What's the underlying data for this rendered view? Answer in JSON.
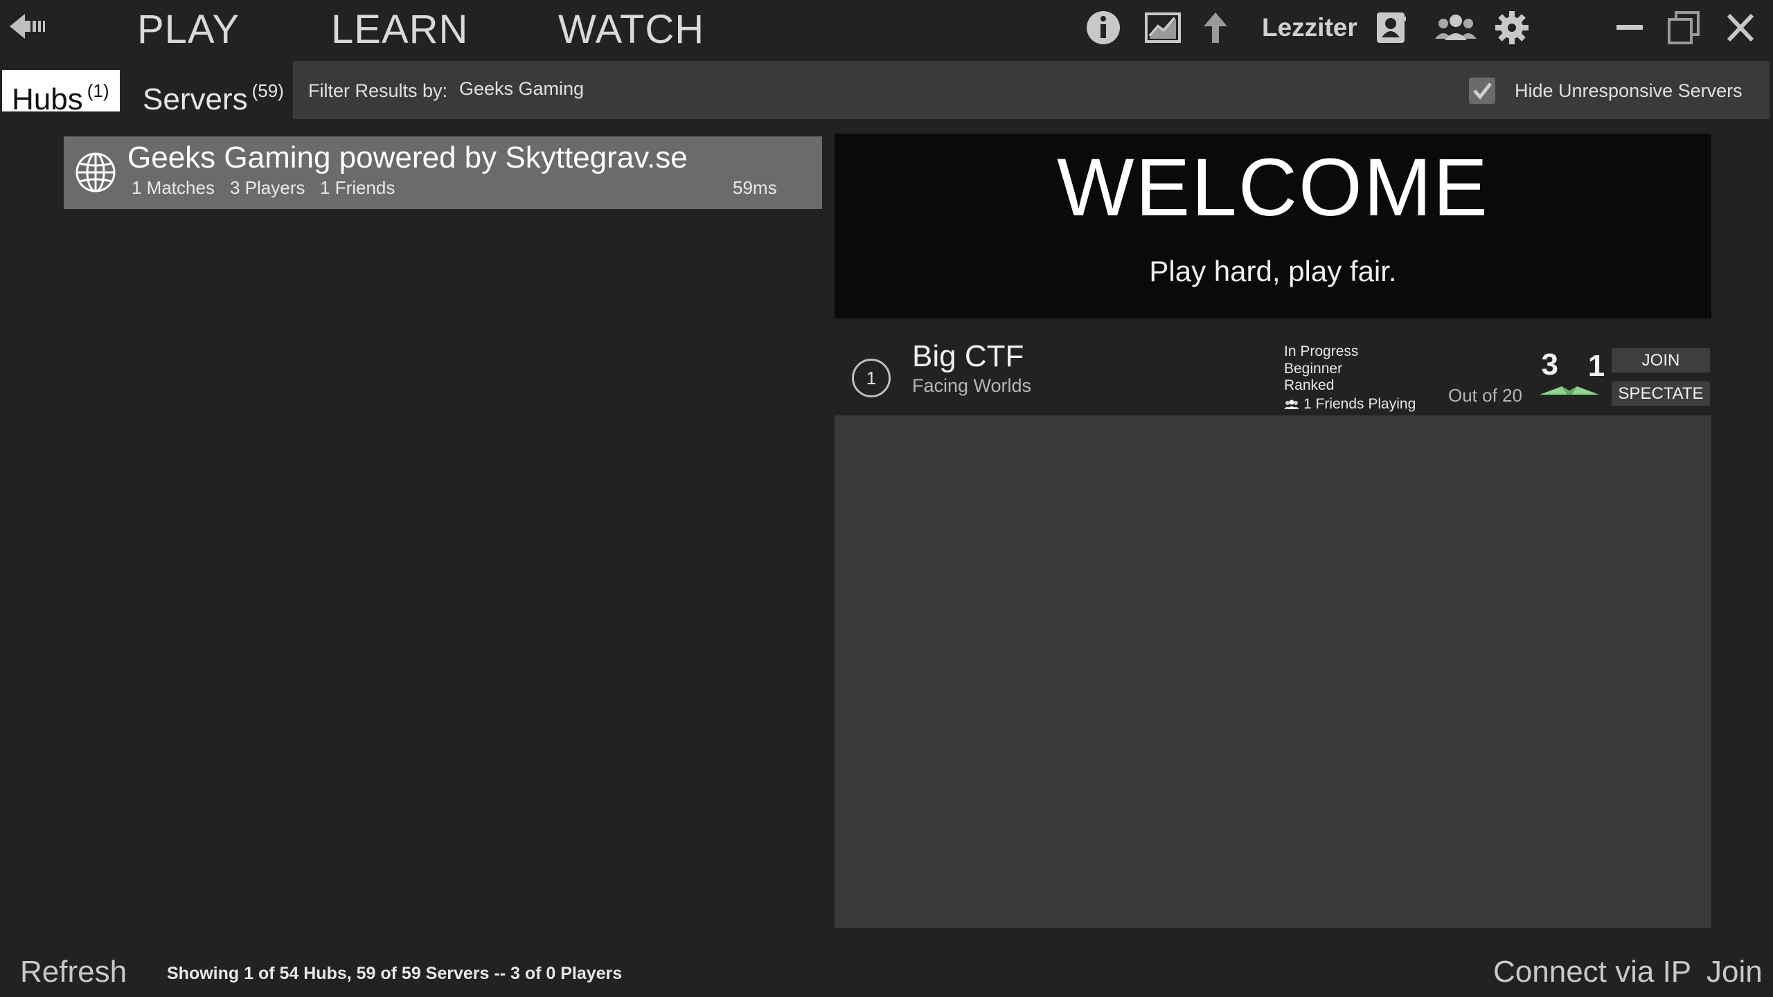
{
  "nav": {
    "play": "PLAY",
    "learn": "LEARN",
    "watch": "WATCH"
  },
  "toolbar": {
    "username": "Lezziter",
    "icons": [
      "back-arrow-icon",
      "info-icon",
      "stats-chart-icon",
      "up-arrow-icon",
      "profile-icon",
      "friends-icon",
      "gear-icon",
      "minimize-icon",
      "restore-icon",
      "close-icon"
    ]
  },
  "tabs": {
    "hubs": {
      "label": "Hubs",
      "count": "(1)"
    },
    "servers": {
      "label": "Servers",
      "count": "(59)"
    }
  },
  "filter": {
    "label": "Filter Results by:",
    "value": "Geeks Gaming",
    "hide_unresponsive_label": "Hide Unresponsive Servers",
    "hide_unresponsive_checked": true
  },
  "hubs": [
    {
      "name": "Geeks Gaming powered by Skyttegrav.se",
      "matches": "1 Matches",
      "players": "3 Players",
      "friends": "1 Friends",
      "ping": "59ms"
    }
  ],
  "welcome": {
    "title": "WELCOME",
    "subtitle": "Play hard, play fair."
  },
  "match": {
    "number": "1",
    "title": "Big CTF",
    "map": "Facing Worlds",
    "status": "In Progress",
    "skill": "Beginner",
    "ranked": "Ranked",
    "friends_playing": "1 Friends Playing",
    "players": "3",
    "capacity": "Out of 20",
    "team_count": "1",
    "join_label": "JOIN",
    "spectate_label": "SPECTATE"
  },
  "footer": {
    "refresh": "Refresh",
    "status": "Showing 1 of 54 Hubs, 59 of 59 Servers -- 3 of 0 Players",
    "connect_ip": "Connect via IP",
    "join": "Join"
  },
  "colors": {
    "background": "#222222",
    "panel": "#3a3a3a",
    "hub_row": "#6b6b6b",
    "welcome_bg": "#0a0a0a",
    "team_green": "#8fd48f"
  }
}
